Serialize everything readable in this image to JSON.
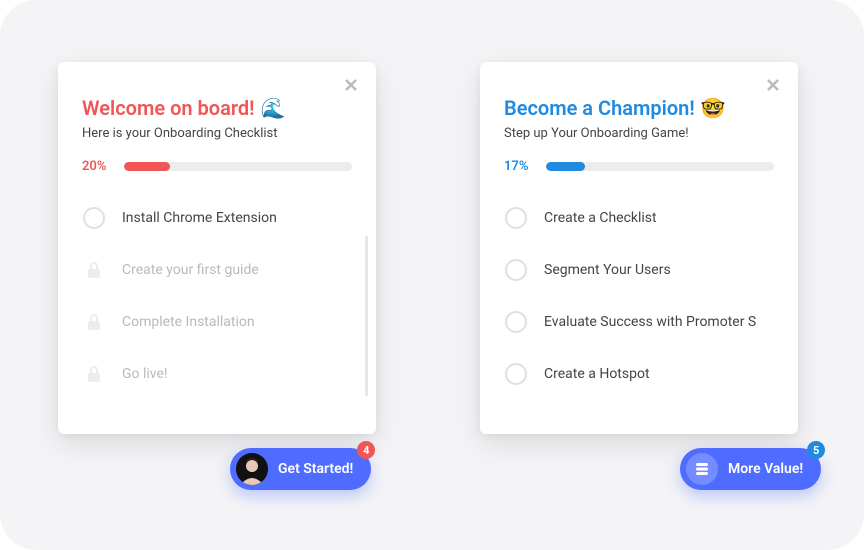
{
  "panels": [
    {
      "title": "Welcome on board!",
      "emoji": "🌊",
      "subtitle": "Here is your Onboarding Checklist",
      "progress_label": "20%",
      "progress_pct": 20,
      "accent": "#f05656",
      "items": [
        {
          "label": "Install Chrome Extension",
          "locked": false
        },
        {
          "label": "Create your first guide",
          "locked": true
        },
        {
          "label": "Complete Installation",
          "locked": true
        },
        {
          "label": "Go live!",
          "locked": true
        }
      ]
    },
    {
      "title": "Become a Champion!",
      "emoji": "🤓",
      "subtitle": "Step up Your Onboarding Game!",
      "progress_label": "17%",
      "progress_pct": 17,
      "accent": "#1f8ae0",
      "items": [
        {
          "label": "Create a Checklist",
          "locked": false
        },
        {
          "label": "Segment Your Users",
          "locked": false
        },
        {
          "label": "Evaluate Success with Promoter S",
          "locked": false
        },
        {
          "label": "Create a Hotspot",
          "locked": false
        }
      ]
    }
  ],
  "fabs": [
    {
      "label": "Get Started!",
      "badge": "4",
      "badge_color": "red",
      "icon": "avatar"
    },
    {
      "label": "More Value!",
      "badge": "5",
      "badge_color": "blue",
      "icon": "stack"
    }
  ]
}
